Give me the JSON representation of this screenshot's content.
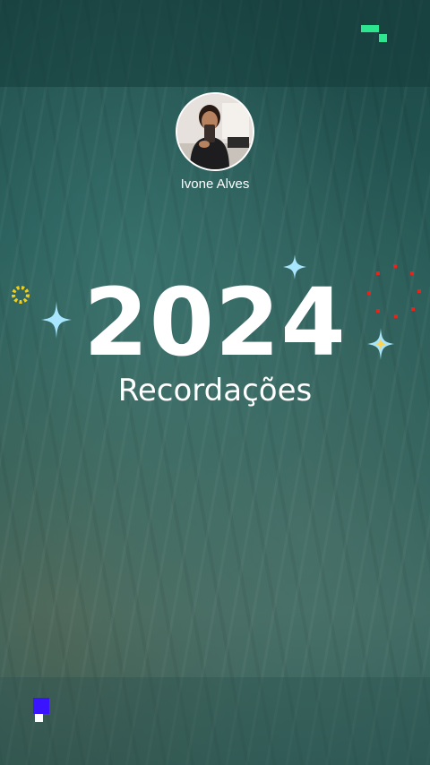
{
  "profile": {
    "name": "Ivone Alves"
  },
  "recap": {
    "year": "2024",
    "subtitle": "Recordações"
  },
  "icons": {
    "brand": "brand-logo-icon",
    "sparkles": [
      "sparkle-icon",
      "sparkle-icon",
      "sparkle-icon"
    ],
    "confetti": [
      "yellow-ring-icon",
      "red-dot-ring-icon"
    ],
    "corner": "square-mark-icon"
  },
  "colors": {
    "brand_green": "#2ee58f",
    "sparkle": "#a8e6ff",
    "sparkle_gold": "#ffd34d",
    "confetti_yellow": "#f2cf1b",
    "confetti_red": "#e0271f",
    "corner_blue": "#3a14ff"
  }
}
